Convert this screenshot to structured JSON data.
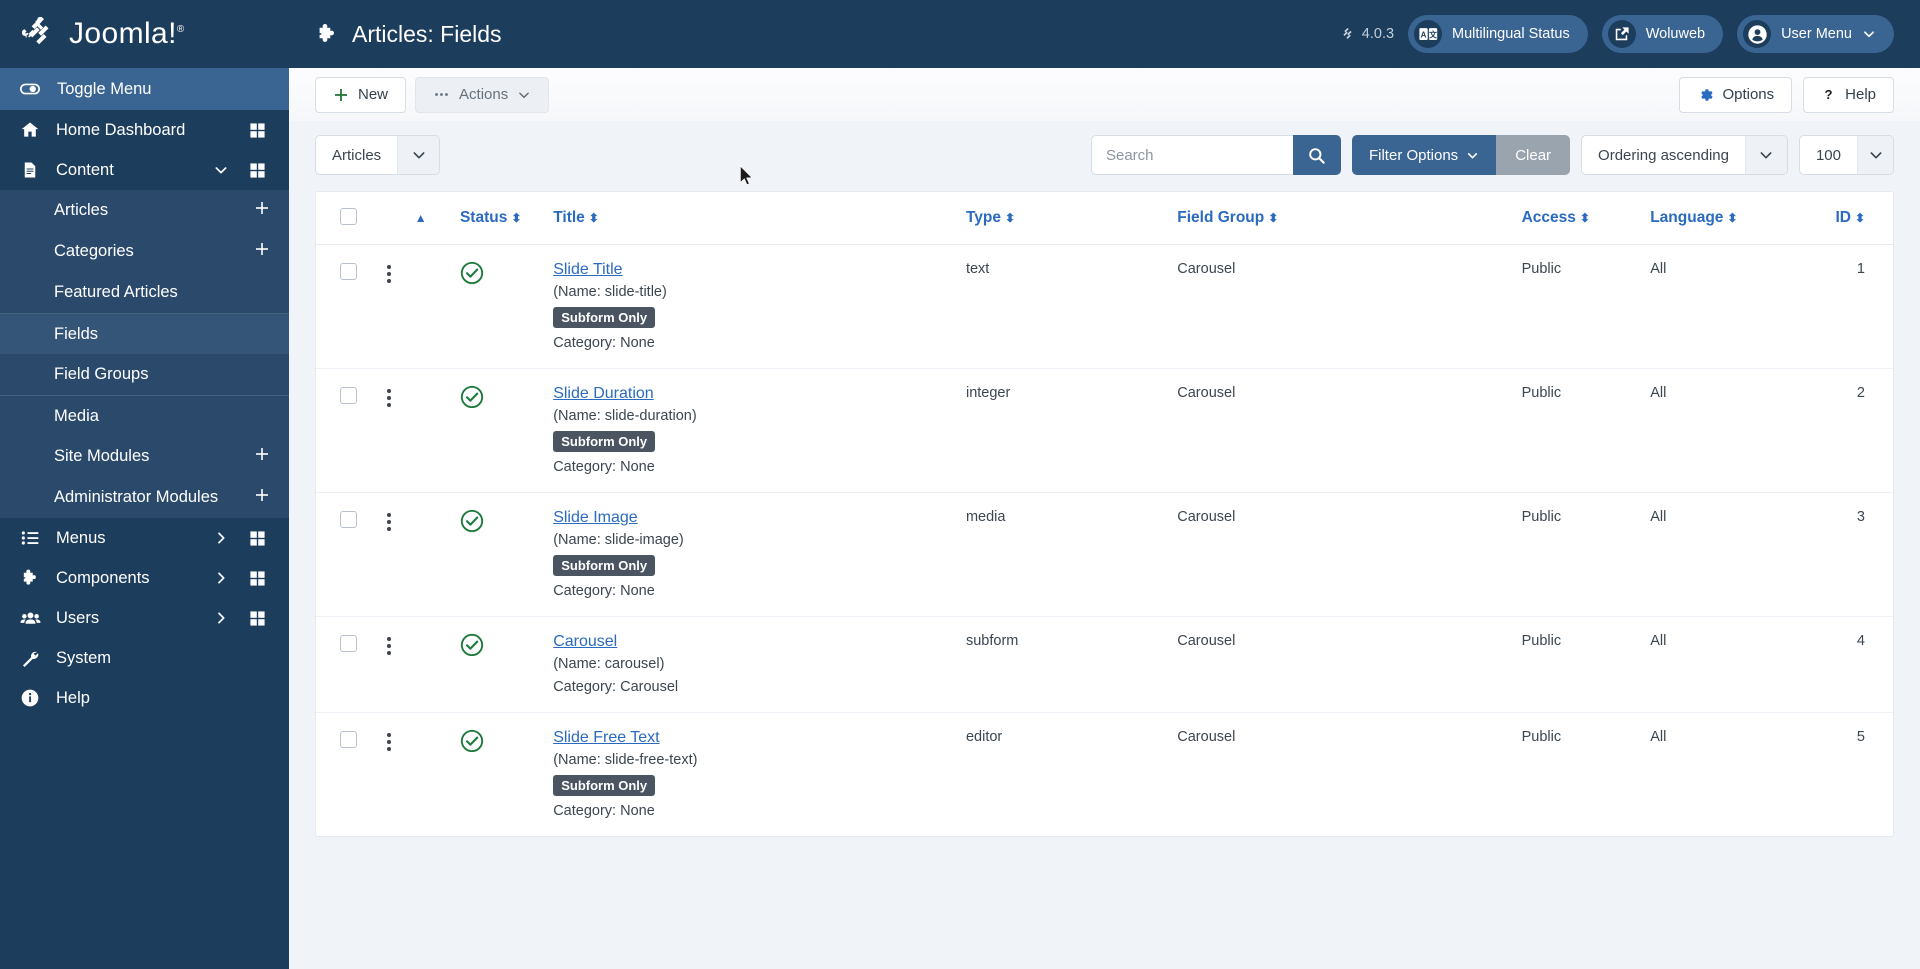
{
  "brand": {
    "name": "Joomla!",
    "trademark": "®"
  },
  "sidebar": {
    "toggle_label": "Toggle Menu",
    "items": [
      {
        "label": "Home Dashboard",
        "icon": "home-icon",
        "has_caret": false,
        "has_grid": true
      },
      {
        "label": "Content",
        "icon": "document-icon",
        "has_caret": true,
        "has_grid": true
      }
    ],
    "content_submenu": [
      {
        "label": "Articles",
        "has_plus": true,
        "selected": false,
        "divider": false
      },
      {
        "label": "Categories",
        "has_plus": true,
        "selected": false,
        "divider": false
      },
      {
        "label": "Featured Articles",
        "has_plus": false,
        "selected": false,
        "divider": false
      },
      {
        "label": "Fields",
        "has_plus": false,
        "selected": true,
        "divider": true
      },
      {
        "label": "Field Groups",
        "has_plus": false,
        "selected": false,
        "divider": false
      },
      {
        "label": "Media",
        "has_plus": false,
        "selected": false,
        "divider": true
      },
      {
        "label": "Site Modules",
        "has_plus": true,
        "selected": false,
        "divider": false
      },
      {
        "label": "Administrator Modules",
        "has_plus": true,
        "selected": false,
        "divider": false
      }
    ],
    "lower_items": [
      {
        "label": "Menus",
        "icon": "list-icon",
        "has_caret": true,
        "has_grid": true
      },
      {
        "label": "Components",
        "icon": "puzzle-icon",
        "has_caret": true,
        "has_grid": true
      },
      {
        "label": "Users",
        "icon": "users-icon",
        "has_caret": true,
        "has_grid": true
      },
      {
        "label": "System",
        "icon": "wrench-icon",
        "has_caret": false,
        "has_grid": false
      },
      {
        "label": "Help",
        "icon": "info-icon",
        "has_caret": false,
        "has_grid": false
      }
    ]
  },
  "header": {
    "title": "Articles: Fields",
    "version": "4.0.3",
    "multilingual_status": "Multilingual Status",
    "site_name": "Woluweb",
    "user_menu": "User Menu"
  },
  "toolbar": {
    "new_label": "New",
    "actions_label": "Actions",
    "options_label": "Options",
    "help_label": "Help"
  },
  "filters": {
    "context_value": "Articles",
    "search_placeholder": "Search",
    "search_value": "",
    "filter_options_label": "Filter Options",
    "clear_label": "Clear",
    "ordering_value": "Ordering ascending",
    "limit_value": "100"
  },
  "table": {
    "columns": [
      {
        "key": "checkbox",
        "label": "",
        "sortable": false
      },
      {
        "key": "kebab",
        "label": "",
        "sortable": false
      },
      {
        "key": "ordering",
        "label": "",
        "sortable": true
      },
      {
        "key": "status",
        "label": "Status",
        "sortable": true
      },
      {
        "key": "title",
        "label": "Title",
        "sortable": true
      },
      {
        "key": "type",
        "label": "Type",
        "sortable": true
      },
      {
        "key": "field_group",
        "label": "Field Group",
        "sortable": true
      },
      {
        "key": "access",
        "label": "Access",
        "sortable": true
      },
      {
        "key": "language",
        "label": "Language",
        "sortable": true
      },
      {
        "key": "id",
        "label": "ID",
        "sortable": true
      }
    ],
    "rows": [
      {
        "status": "published",
        "title": "Slide Title",
        "name_line": "(Name: slide-title)",
        "tag": "Subform Only",
        "category_line": "Category: None",
        "type": "text",
        "field_group": "Carousel",
        "access": "Public",
        "language": "All",
        "id": "1"
      },
      {
        "status": "published",
        "title": "Slide Duration",
        "name_line": "(Name: slide-duration)",
        "tag": "Subform Only",
        "category_line": "Category: None",
        "type": "integer",
        "field_group": "Carousel",
        "access": "Public",
        "language": "All",
        "id": "2"
      },
      {
        "status": "published",
        "title": "Slide Image",
        "name_line": "(Name: slide-image)",
        "tag": "Subform Only",
        "category_line": "Category: None",
        "type": "media",
        "field_group": "Carousel",
        "access": "Public",
        "language": "All",
        "id": "3"
      },
      {
        "status": "published",
        "title": "Carousel",
        "name_line": "(Name: carousel)",
        "tag": "",
        "category_line": "Category: Carousel",
        "type": "subform",
        "field_group": "Carousel",
        "access": "Public",
        "language": "All",
        "id": "4"
      },
      {
        "status": "published",
        "title": "Slide Free Text",
        "name_line": "(Name: slide-free-text)",
        "tag": "Subform Only",
        "category_line": "Category: None",
        "type": "editor",
        "field_group": "Carousel",
        "access": "Public",
        "language": "All",
        "id": "5"
      }
    ]
  },
  "colors": {
    "sidebar_bg": "#1c3d5c",
    "accent_blue": "#3a6491",
    "link_blue": "#2a6bbf",
    "status_green": "#1f7a3d",
    "tag_gray": "#4a5561"
  }
}
